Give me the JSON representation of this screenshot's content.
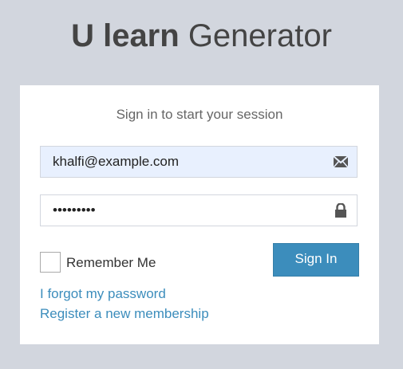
{
  "logo": {
    "bold": "U learn",
    "light": "Generator"
  },
  "login": {
    "message": "Sign in to start your session",
    "email_value": "khalfi@example.com",
    "password_value": "•••••••••",
    "remember_label": "Remember Me",
    "signin_label": "Sign In",
    "forgot_link": "I forgot my password",
    "register_link": "Register a new membership"
  },
  "icons": {
    "email": "envelope-icon",
    "password": "lock-icon"
  },
  "colors": {
    "background": "#d2d6de",
    "primary": "#3c8dbc",
    "autofill": "#e8f0fe"
  }
}
